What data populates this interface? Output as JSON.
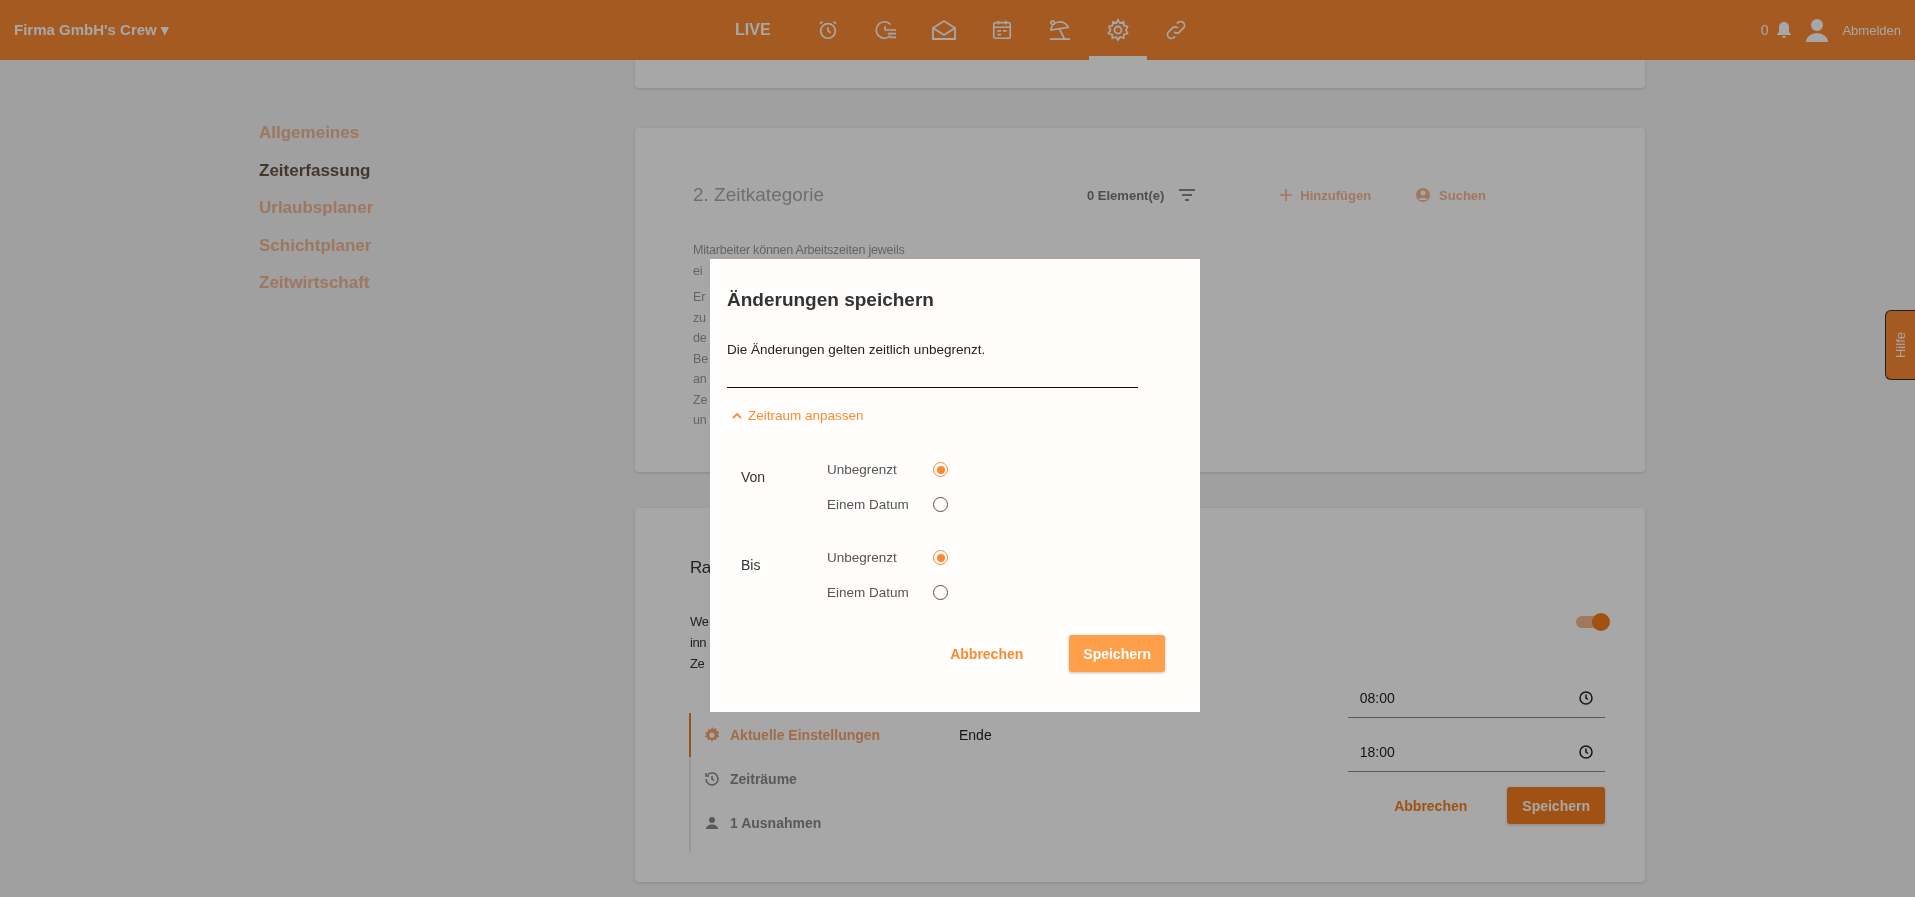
{
  "topbar": {
    "company": "Firma GmbH's Crew",
    "caret": "▾",
    "live": "LIVE",
    "nav_icons": [
      {
        "kind": "alarm",
        "selected": false
      },
      {
        "kind": "timer",
        "selected": false
      },
      {
        "kind": "mail",
        "selected": false
      },
      {
        "kind": "calendar",
        "selected": false
      },
      {
        "kind": "umbrella",
        "selected": false
      },
      {
        "kind": "gear",
        "selected": true
      },
      {
        "kind": "link",
        "selected": false
      }
    ],
    "notifications": "0",
    "logout": "Abmelden"
  },
  "settings_nav": [
    {
      "label": "Allgemeines",
      "selected": false
    },
    {
      "label": "Zeiterfassung",
      "selected": true
    },
    {
      "label": "Urlaubsplaner",
      "selected": false
    },
    {
      "label": "Schichtplaner",
      "selected": false
    },
    {
      "label": "Zeitwirtschaft",
      "selected": false
    }
  ],
  "category_card": {
    "title": "2. Zeitkategorie",
    "count": "0 Element(e)",
    "add": "Hinzufügen",
    "search": "Suchen",
    "text_lines": [
      "Mitarbeiter können Arbeitszeiten jeweils",
      "ei"
    ],
    "text_lines_2": [
      "Er",
      "zu",
      "de",
      "Be",
      "an",
      "Ze",
      "un"
    ]
  },
  "rule_card": {
    "title": "Ra",
    "text_lines": [
      "We",
      "inn",
      "Ze"
    ],
    "toggle_on": true,
    "tabs": [
      {
        "kind": "settings",
        "label": "Aktuelle Einstellungen",
        "selected": true
      },
      {
        "kind": "history",
        "label": "Zeiträume",
        "selected": false
      },
      {
        "kind": "person",
        "label": "1 Ausnahmen",
        "selected": false
      }
    ],
    "start_time": "08:00",
    "end_label": "Ende",
    "end_time": "18:00",
    "cancel": "Abbrechen",
    "save": "Speichern"
  },
  "help_tab": "Hilfe",
  "dialog": {
    "title": "Änderungen speichern",
    "message": "Die Änderungen gelten zeitlich unbegrenzt.",
    "expander": {
      "label": "Zeitraum anpassen",
      "expanded": true
    },
    "groups": [
      {
        "label": "Von",
        "options": [
          {
            "label": "Unbegrenzt",
            "selected": true
          },
          {
            "label": "Einem Datum",
            "selected": false
          }
        ]
      },
      {
        "label": "Bis",
        "options": [
          {
            "label": "Unbegrenzt",
            "selected": true
          },
          {
            "label": "Einem Datum",
            "selected": false
          }
        ]
      }
    ],
    "cancel": "Abbrechen",
    "save": "Speichern"
  }
}
